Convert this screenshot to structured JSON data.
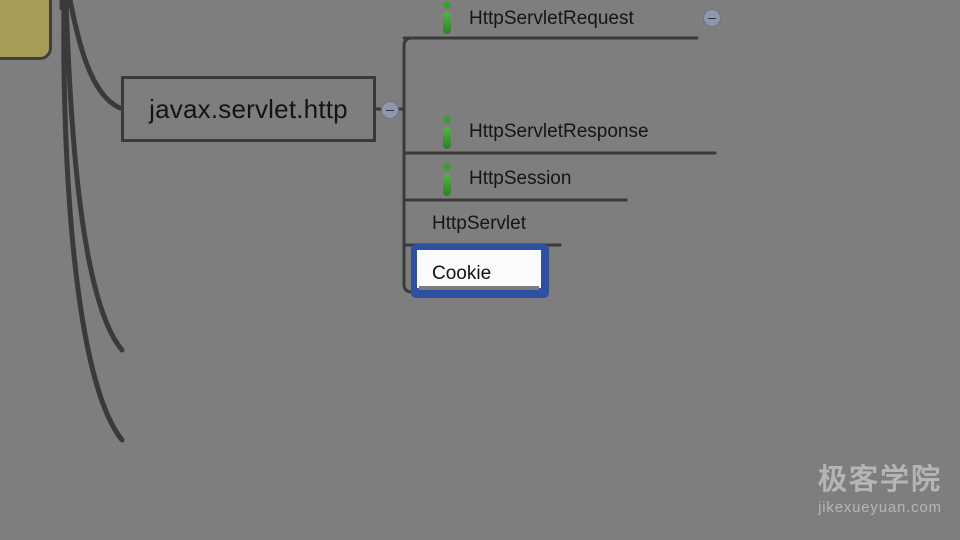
{
  "mindmap": {
    "package_node": {
      "label": "javax.servlet.http"
    },
    "children": [
      {
        "label": "HttpServletRequest",
        "icon": "interface-icon"
      },
      {
        "label": "HttpServletResponse",
        "icon": "interface-icon"
      },
      {
        "label": "HttpSession",
        "icon": "interface-icon"
      },
      {
        "label": "HttpServlet"
      }
    ],
    "selected_child": {
      "label": "Cookie"
    }
  },
  "watermark": {
    "name": "极客学院",
    "url": "jikexueyuan.com"
  },
  "colors": {
    "background": "#7e7e7e",
    "root_node_fill": "#a69c55",
    "connector": "#3a3a3a",
    "selection_border": "#2f4fa0",
    "interface_icon": "#3f9a38"
  }
}
